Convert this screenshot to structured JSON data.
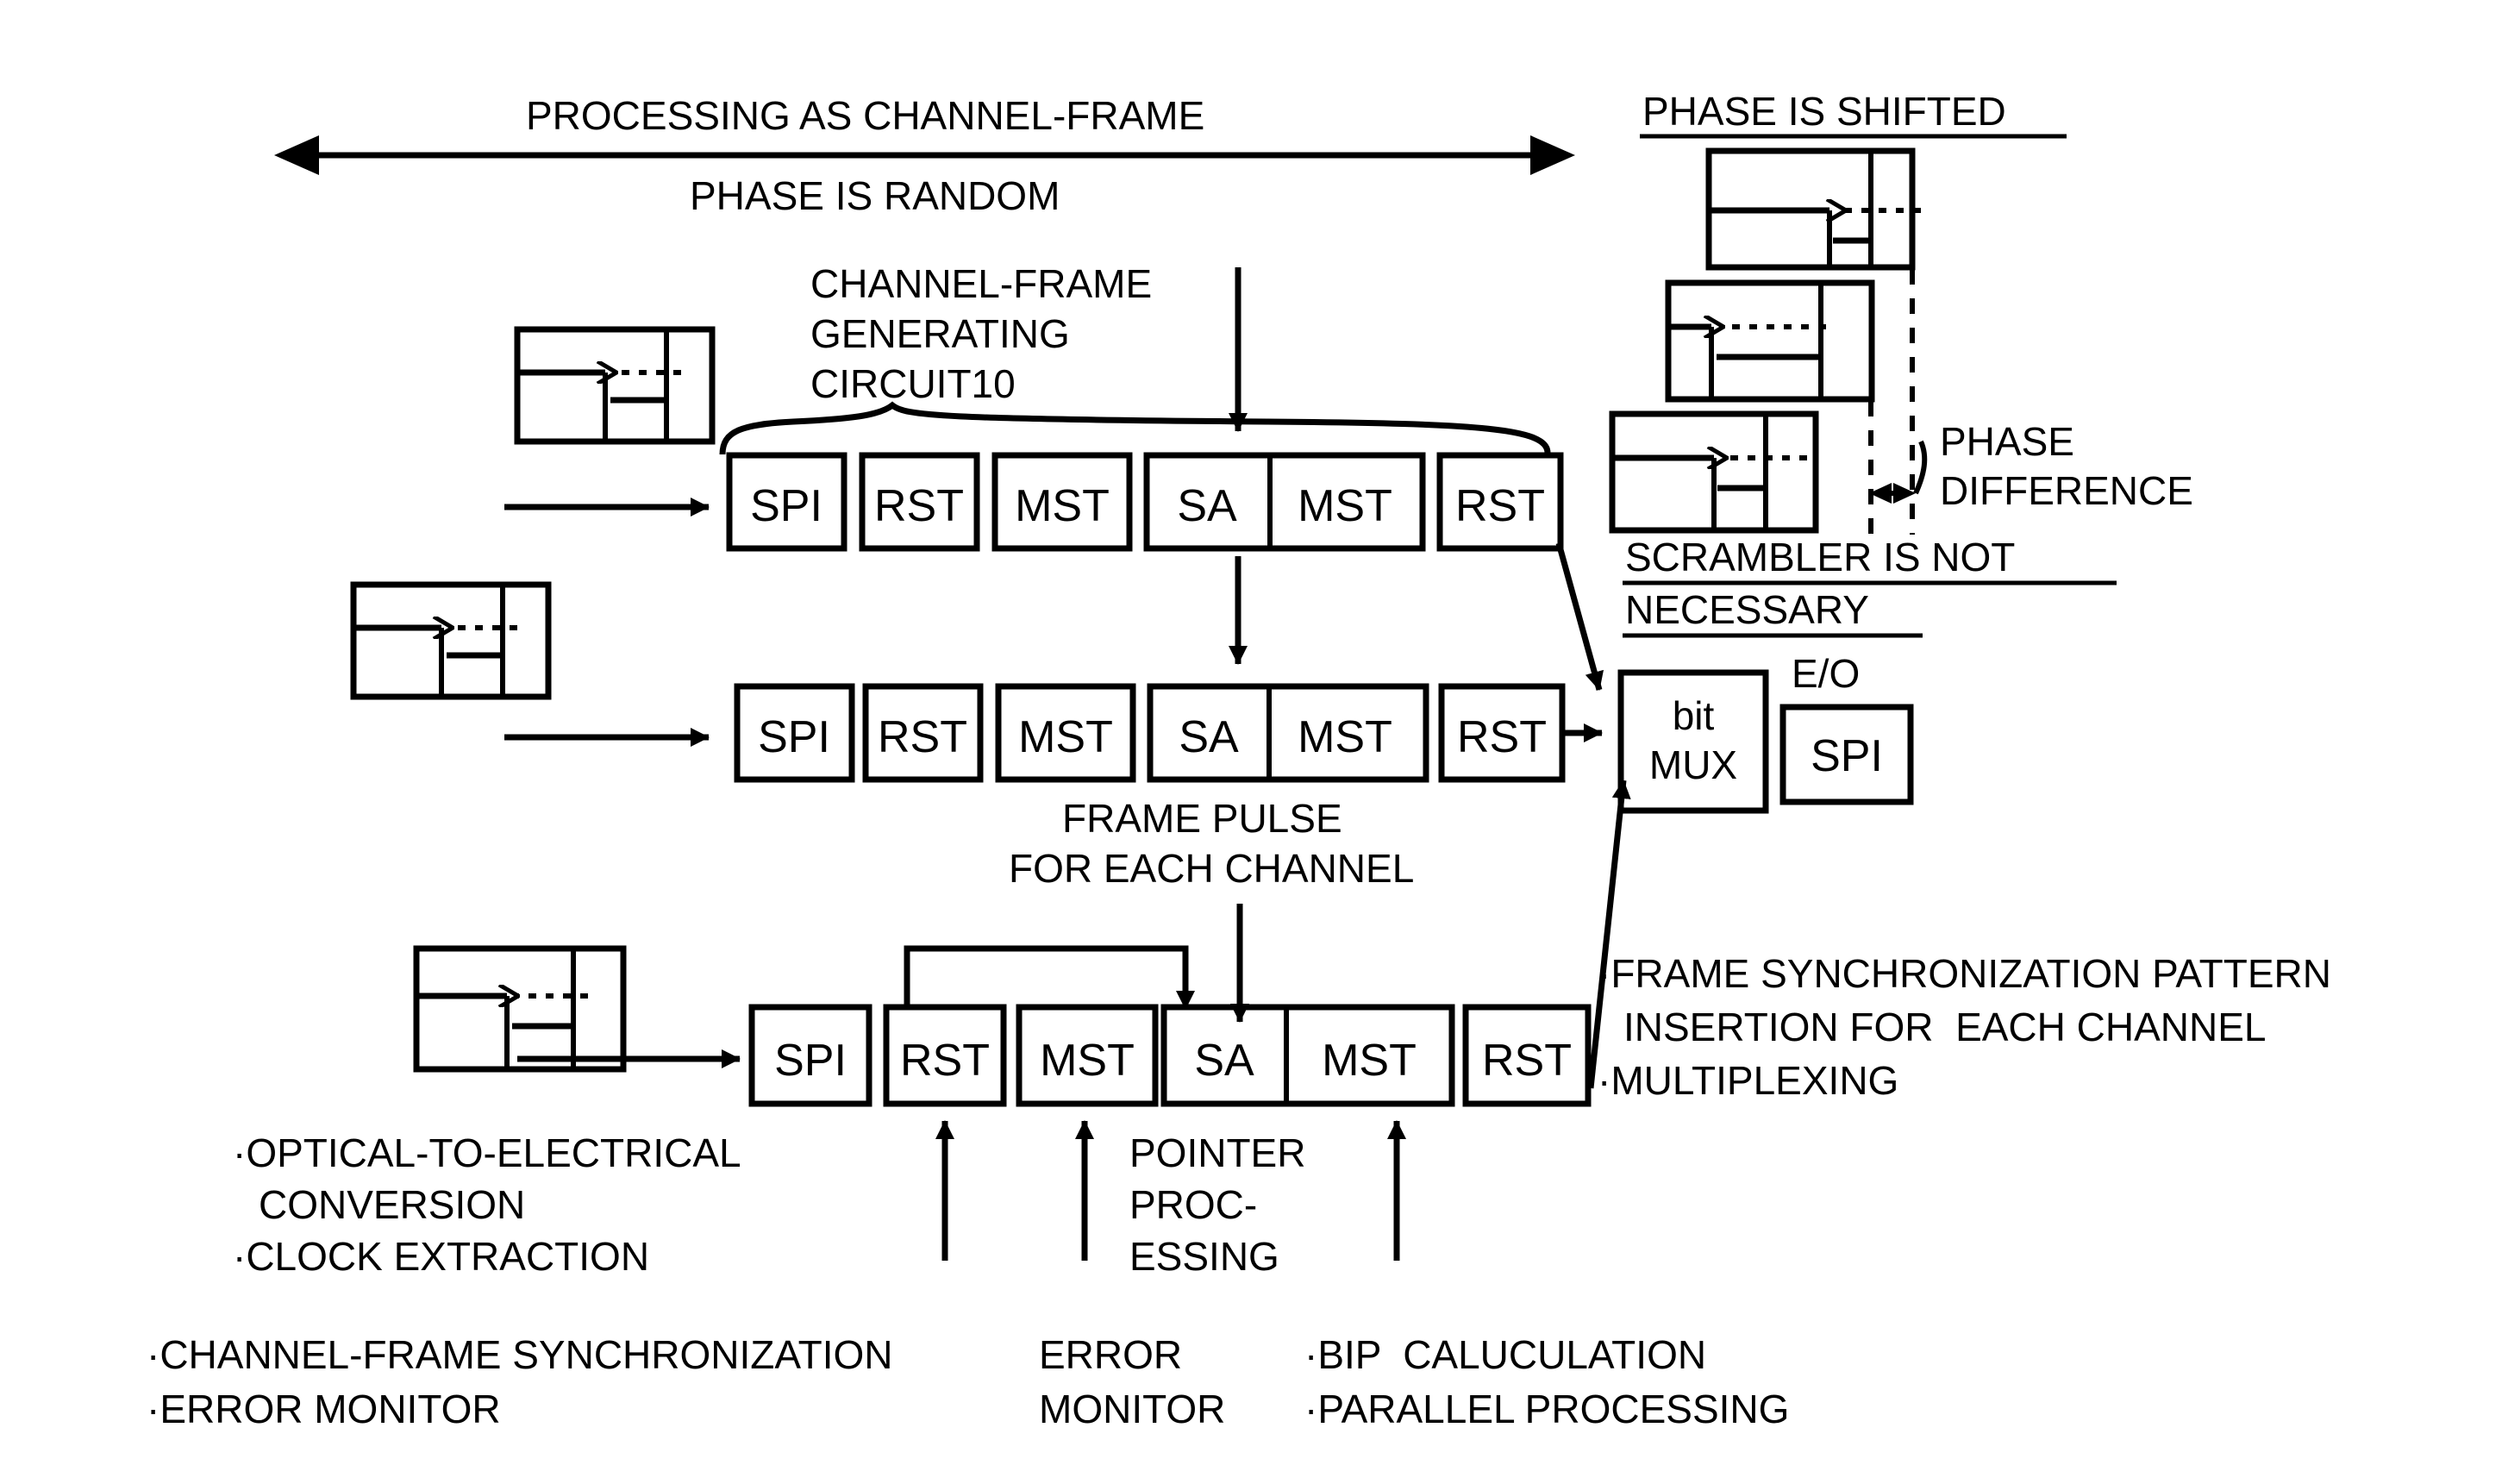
{
  "diagram": {
    "title_top": "PROCESSING AS CHANNEL-FRAME",
    "subtitle_top": "PHASE IS RANDOM",
    "phase_shifted_label": "PHASE IS SHIFTED",
    "generating_circuit": {
      "line1": "CHANNEL-FRAME",
      "line2": "GENERATING",
      "line3": "CIRCUIT10"
    },
    "frame_pulse": {
      "line1": "FRAME PULSE",
      "line2": "FOR EACH CHANNEL"
    },
    "phase_difference": {
      "line1": "PHASE",
      "line2": "DIFFERENCE"
    },
    "scrambler_note": {
      "line1": "SCRAMBLER IS NOT",
      "line2": "NECESSARY"
    },
    "eo_label": "E/O",
    "mux": {
      "line1": "bit",
      "line2": "MUX"
    },
    "eo_box_label": "SPI",
    "rows": [
      {
        "id": "row-1",
        "blocks": [
          "SPI",
          "RST",
          "MST",
          "SA",
          "MST",
          "RST"
        ]
      },
      {
        "id": "row-2",
        "blocks": [
          "SPI",
          "RST",
          "MST",
          "SA",
          "MST",
          "RST"
        ]
      },
      {
        "id": "row-3",
        "blocks": [
          "SPI",
          "RST",
          "MST",
          "SA",
          "MST",
          "RST"
        ]
      }
    ],
    "annotations": {
      "optical_conversion_l1": "·OPTICAL-TO-ELECTRICAL",
      "optical_conversion_l2": "CONVERSION",
      "clock_extraction": "·CLOCK EXTRACTION",
      "channel_frame_sync": "·CHANNEL-FRAME SYNCHRONIZATION",
      "error_monitor_left": "·ERROR MONITOR",
      "error_l1": "ERROR",
      "error_l2": "MONITOR",
      "pointer_l1": "POINTER",
      "pointer_l2": "PROC-",
      "pointer_l3": "ESSING",
      "bip": "·BIP  CALUCULATION",
      "parallel": "·PARALLEL PROCESSING",
      "frame_sync_pattern_l1": "·FRAME SYNCHRONIZATION PATTERN",
      "frame_sync_pattern_l2": "INSERTION FOR  EACH CHANNEL",
      "multiplexing": "·MULTIPLEXING"
    },
    "colors": {
      "ink": "#000000",
      "paper": "#ffffff"
    }
  }
}
